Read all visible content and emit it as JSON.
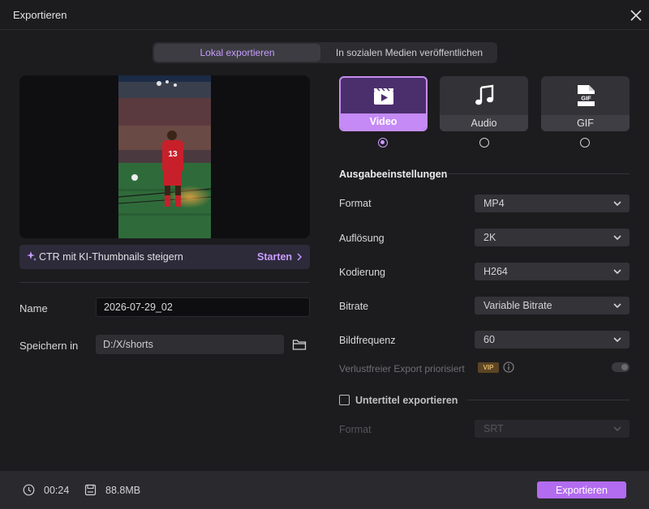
{
  "window": {
    "title": "Exportieren"
  },
  "tabs": {
    "local": "Lokal exportieren",
    "social": "In sozialen Medien veröffentlichen"
  },
  "promo": {
    "text": "CTR mit KI-Thumbnails steigern",
    "action": "Starten"
  },
  "fields": {
    "name_label": "Name",
    "name_value": "2026-07-29_02",
    "save_label": "Speichern in",
    "save_value": "D:/X/shorts"
  },
  "format_cards": [
    {
      "label": "Video",
      "icon": "film-clapper-icon",
      "selected": true
    },
    {
      "label": "Audio",
      "icon": "music-note-icon",
      "selected": false
    },
    {
      "label": "GIF",
      "icon": "gif-file-icon",
      "selected": false
    }
  ],
  "output": {
    "title": "Ausgabeeinstellungen",
    "rows": [
      {
        "label": "Format",
        "value": "MP4"
      },
      {
        "label": "Auflösung",
        "value": "2K"
      },
      {
        "label": "Kodierung",
        "value": "H264"
      },
      {
        "label": "Bitrate",
        "value": "Variable Bitrate"
      },
      {
        "label": "Bildfrequenz",
        "value": "60"
      }
    ],
    "lossless_label": "Verlustfreier Export priorisiert",
    "vip_badge": "VIP"
  },
  "subtitles": {
    "label": "Untertitel exportieren",
    "format_label": "Format",
    "format_value": "SRT",
    "checked": false
  },
  "footer": {
    "duration": "00:24",
    "size": "88.8MB",
    "export_label": "Exportieren"
  },
  "colors": {
    "accent": "#c58af5",
    "export_button": "#b36cf0",
    "background": "#1c1c1e",
    "footer": "#2a2a2e"
  }
}
